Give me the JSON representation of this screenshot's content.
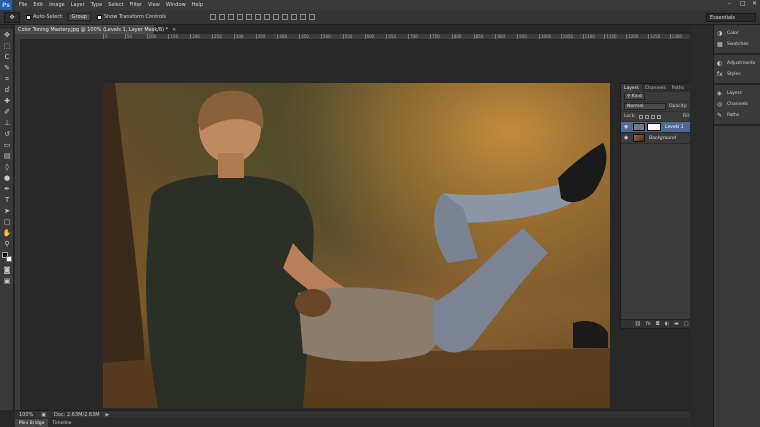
{
  "app": {
    "logo": "Ps"
  },
  "menu": [
    "File",
    "Edit",
    "Image",
    "Layer",
    "Type",
    "Select",
    "Filter",
    "View",
    "Window",
    "Help"
  ],
  "options": {
    "auto_select_label": "Auto-Select:",
    "auto_select_value": "Group",
    "transform_label": "Show Transform Controls",
    "workspace": "Essentials"
  },
  "document": {
    "tab_title": "Color Toning Mastery.jpg @ 100% (Levels 1, Layer Mask/8) *",
    "close": "×"
  },
  "ruler_ticks": [
    "0",
    "50",
    "100",
    "150",
    "200",
    "250",
    "300",
    "350",
    "400",
    "450",
    "500",
    "550",
    "600",
    "650",
    "700",
    "750",
    "800",
    "850",
    "900",
    "950",
    "1000",
    "1050",
    "1100",
    "1150",
    "1200",
    "1250",
    "1300",
    "1350",
    "1400"
  ],
  "status": {
    "zoom": "100%",
    "doc_size": "Doc: 2.63M/2.63M"
  },
  "bottom_tabs": [
    "Mini Bridge",
    "Timeline"
  ],
  "layers_panel": {
    "tabs": [
      "Layers",
      "Channels",
      "Paths"
    ],
    "filter_kind": "Kind",
    "blend_mode": "Normal",
    "opacity_label": "Opacity:",
    "opacity_value": "100%",
    "lock_label": "Lock:",
    "fill_label": "Fill:",
    "fill_value": "100%",
    "layers": [
      {
        "name": "Levels 1",
        "selected": true
      },
      {
        "name": "Background",
        "selected": false
      }
    ],
    "footer_icons": [
      "link-icon",
      "fx-icon",
      "mask-icon",
      "adjustment-icon",
      "folder-icon",
      "new-layer-icon",
      "trash-icon"
    ]
  },
  "right_dock": {
    "group1": [
      "Color",
      "Swatches"
    ],
    "group2": [
      "Adjustments",
      "Styles"
    ],
    "group3": [
      "Layers",
      "Channels",
      "Paths"
    ]
  },
  "colors": {
    "selected_layer": "#4d6a95",
    "panel_bg": "#3b3b3b",
    "app_bg": "#282828"
  }
}
